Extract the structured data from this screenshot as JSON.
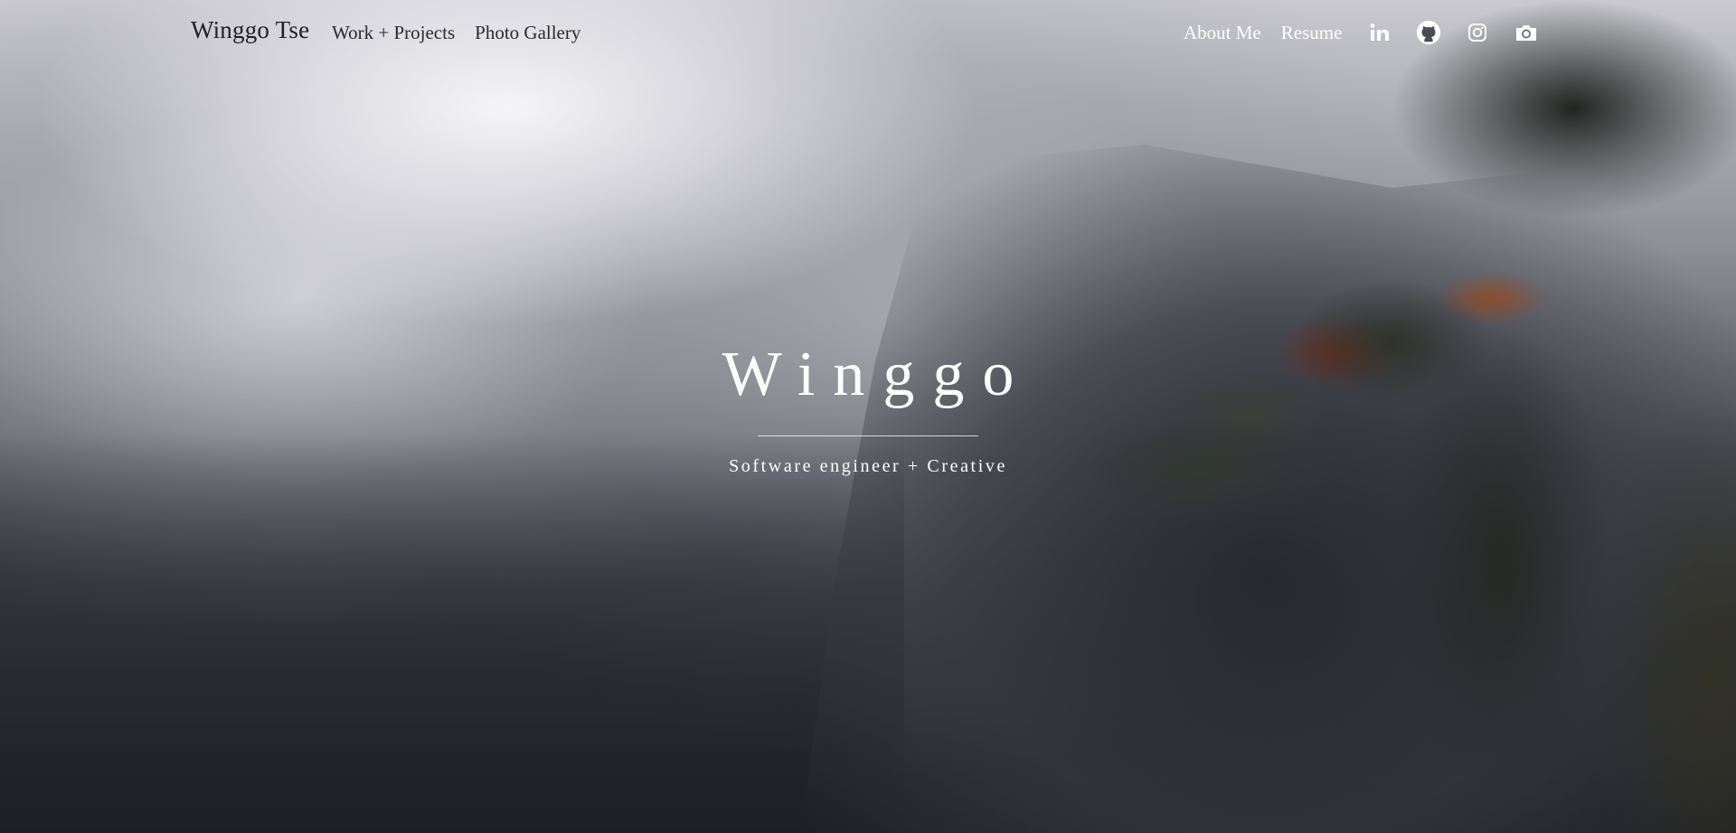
{
  "nav": {
    "brand": "Winggo Tse",
    "left_links": [
      {
        "label": "Work + Projects"
      },
      {
        "label": "Photo Gallery"
      }
    ],
    "right_links": [
      {
        "label": "About Me"
      },
      {
        "label": "Resume"
      }
    ],
    "social_icons": [
      "linkedin-icon",
      "github-icon",
      "instagram-icon",
      "camera-icon"
    ]
  },
  "hero": {
    "name": "Winggo",
    "tagline": "Software engineer + Creative"
  },
  "colors": {
    "nav_dark_text": "#2a2a2d",
    "nav_light_text": "#ffffff",
    "hero_text": "#ffffff"
  }
}
